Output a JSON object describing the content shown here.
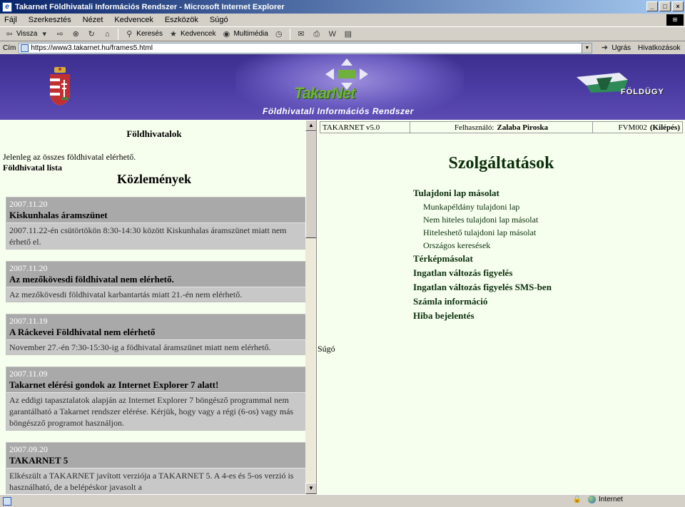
{
  "window": {
    "title": "Takarnet Földhivatali Információs Rendszer - Microsoft Internet Explorer",
    "controls": [
      "_",
      "□",
      "×"
    ]
  },
  "menu": [
    "Fájl",
    "Szerkesztés",
    "Nézet",
    "Kedvencek",
    "Eszközök",
    "Súgó"
  ],
  "toolbar": {
    "back": "Vissza",
    "search": "Keresés",
    "favorites": "Kedvencek",
    "media": "Multimédia"
  },
  "address": {
    "label": "Cím",
    "url": "https://www3.takarnet.hu/frames5.html",
    "go": "Ugrás",
    "links": "Hivatkozások"
  },
  "banner": {
    "logo_text": "TakarNet",
    "subtitle": "Földhivatali Információs Rendszer",
    "partner": "FÖLDÜGY"
  },
  "left": {
    "heading": "Földhivatalok",
    "status": "Jelenleg az összes földhivatal elérhető.",
    "list_link": "Földhivatal lista",
    "news_title": "Közlemények",
    "news": [
      {
        "date": "2007.11.20",
        "title": "Kiskunhalas áramszünet",
        "body": "2007.11.22-én csütörtökön 8:30-14:30 között Kiskunhalas áramszünet miatt nem érhető el."
      },
      {
        "date": "2007.11.20",
        "title": "Az mezőkövesdi földhivatal nem elérhető.",
        "body": "Az mezőkövesdi földhivatal karbantartás miatt 21.-én nem elérhető."
      },
      {
        "date": "2007.11.19",
        "title": "A Ráckevei Földhivatal nem elérhető",
        "body": "November 27.-én 7:30-15:30-ig a födhivatal áramszünet miatt nem elérhető."
      },
      {
        "date": "2007.11.09",
        "title": "Takarnet elérési gondok az Internet Explorer 7 alatt!",
        "body": "Az eddigi tapasztalatok alapján az Internet Explorer 7 böngésző programmal nem garantálható a Takarnet rendszer elérése. Kérjük, hogy vagy a régi (6-os) vagy más böngészző programot használjon."
      },
      {
        "date": "2007.09.20",
        "title": "TAKARNET 5",
        "body": "Elkészült a TAKARNET javított verziója a TAKARNET 5. A 4-es és 5-os verzió is használható, de a belépéskor javasolt a"
      }
    ]
  },
  "right": {
    "version": "TAKARNET v5.0",
    "user_label": "Felhasználó:",
    "user_name": "Zalaba Piroska",
    "code": "FVM002",
    "exit": "(Kilépés)",
    "title": "Szolgáltatások",
    "services": {
      "s1": "Tulajdoni lap másolat",
      "s1a": "Munkapéldány tulajdoni lap",
      "s1b": "Nem hiteles tulajdoni lap másolat",
      "s1c": "Hiteleshető tulajdoni lap másolat",
      "s1d": "Országos keresések",
      "s2": "Térképmásolat",
      "s3": "Ingatlan változás figyelés",
      "s4": "Ingatlan változás figyelés SMS-ben",
      "s5": "Számla információ",
      "s6": "Hiba bejelentés"
    },
    "help": "Súgó"
  },
  "statusbar": {
    "zone": "Internet"
  }
}
